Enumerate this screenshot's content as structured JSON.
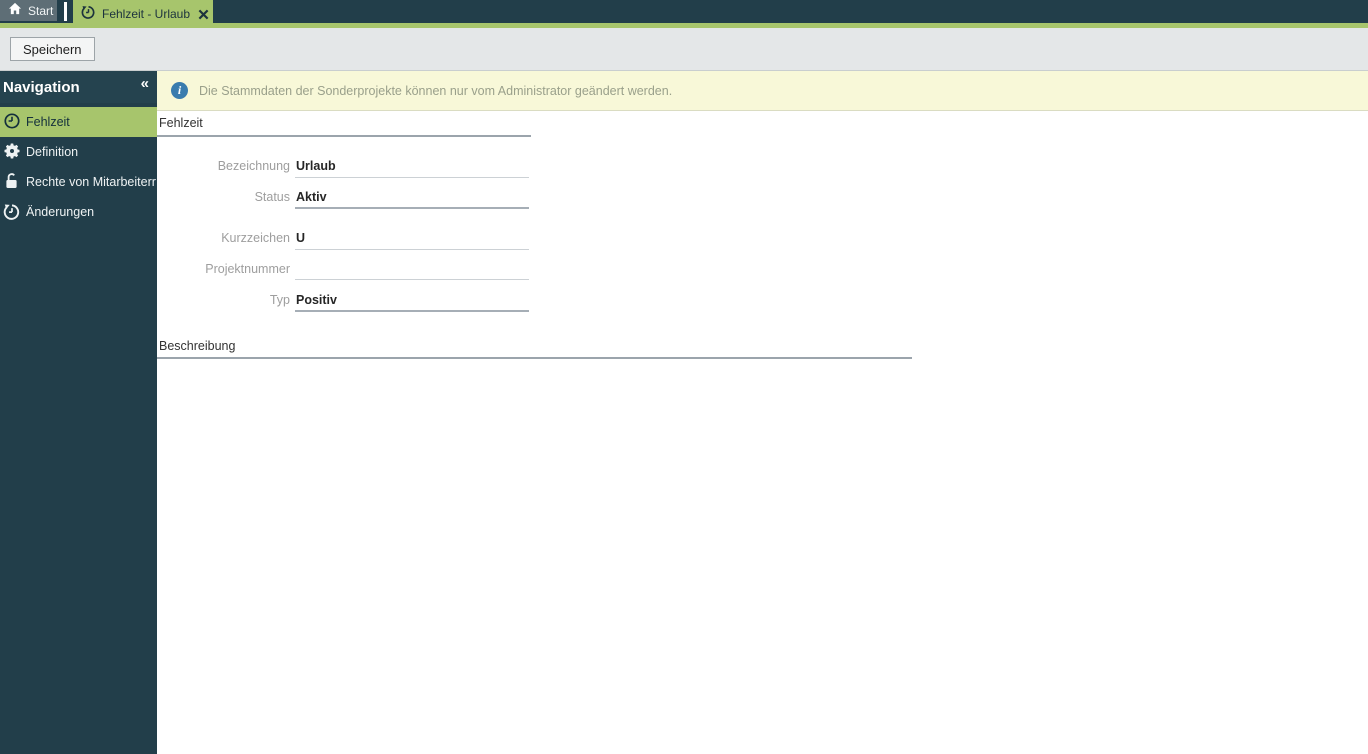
{
  "tabs": {
    "start": {
      "label": "Start",
      "icon": "home-icon"
    },
    "active": {
      "label": "Fehlzeit - Urlaub",
      "icon": "history-icon",
      "close_icon": "close-icon"
    }
  },
  "toolbar": {
    "save_label": "Speichern"
  },
  "sidebar": {
    "title": "Navigation",
    "collapse_glyph": "«",
    "items": [
      {
        "label": "Fehlzeit",
        "icon": "clock-icon",
        "active": true
      },
      {
        "label": "Definition",
        "icon": "gear-icon",
        "active": false
      },
      {
        "label": "Rechte von Mitarbeiterr",
        "icon": "lock-open-icon",
        "active": false
      },
      {
        "label": "Änderungen",
        "icon": "history-icon",
        "active": false
      }
    ]
  },
  "banner": {
    "icon": "info-icon",
    "text": "Die Stammdaten der Sonderprojekte können nur vom Administrator geändert werden."
  },
  "form": {
    "section1_title": "Fehlzeit",
    "fields": [
      {
        "label": "Bezeichnung",
        "value": "Urlaub"
      },
      {
        "label": "Status",
        "value": "Aktiv"
      },
      {
        "label": "Kurzzeichen",
        "value": "U"
      },
      {
        "label": "Projektnummer",
        "value": ""
      },
      {
        "label": "Typ",
        "value": "Positiv"
      }
    ],
    "section2_title": "Beschreibung"
  },
  "colors": {
    "accent_green": "#a7c56c",
    "dark_teal": "#223e4a",
    "toolbar_gray": "#e4e7e8",
    "banner_yellow": "#f8f8d8",
    "info_blue": "#3a7cae"
  }
}
